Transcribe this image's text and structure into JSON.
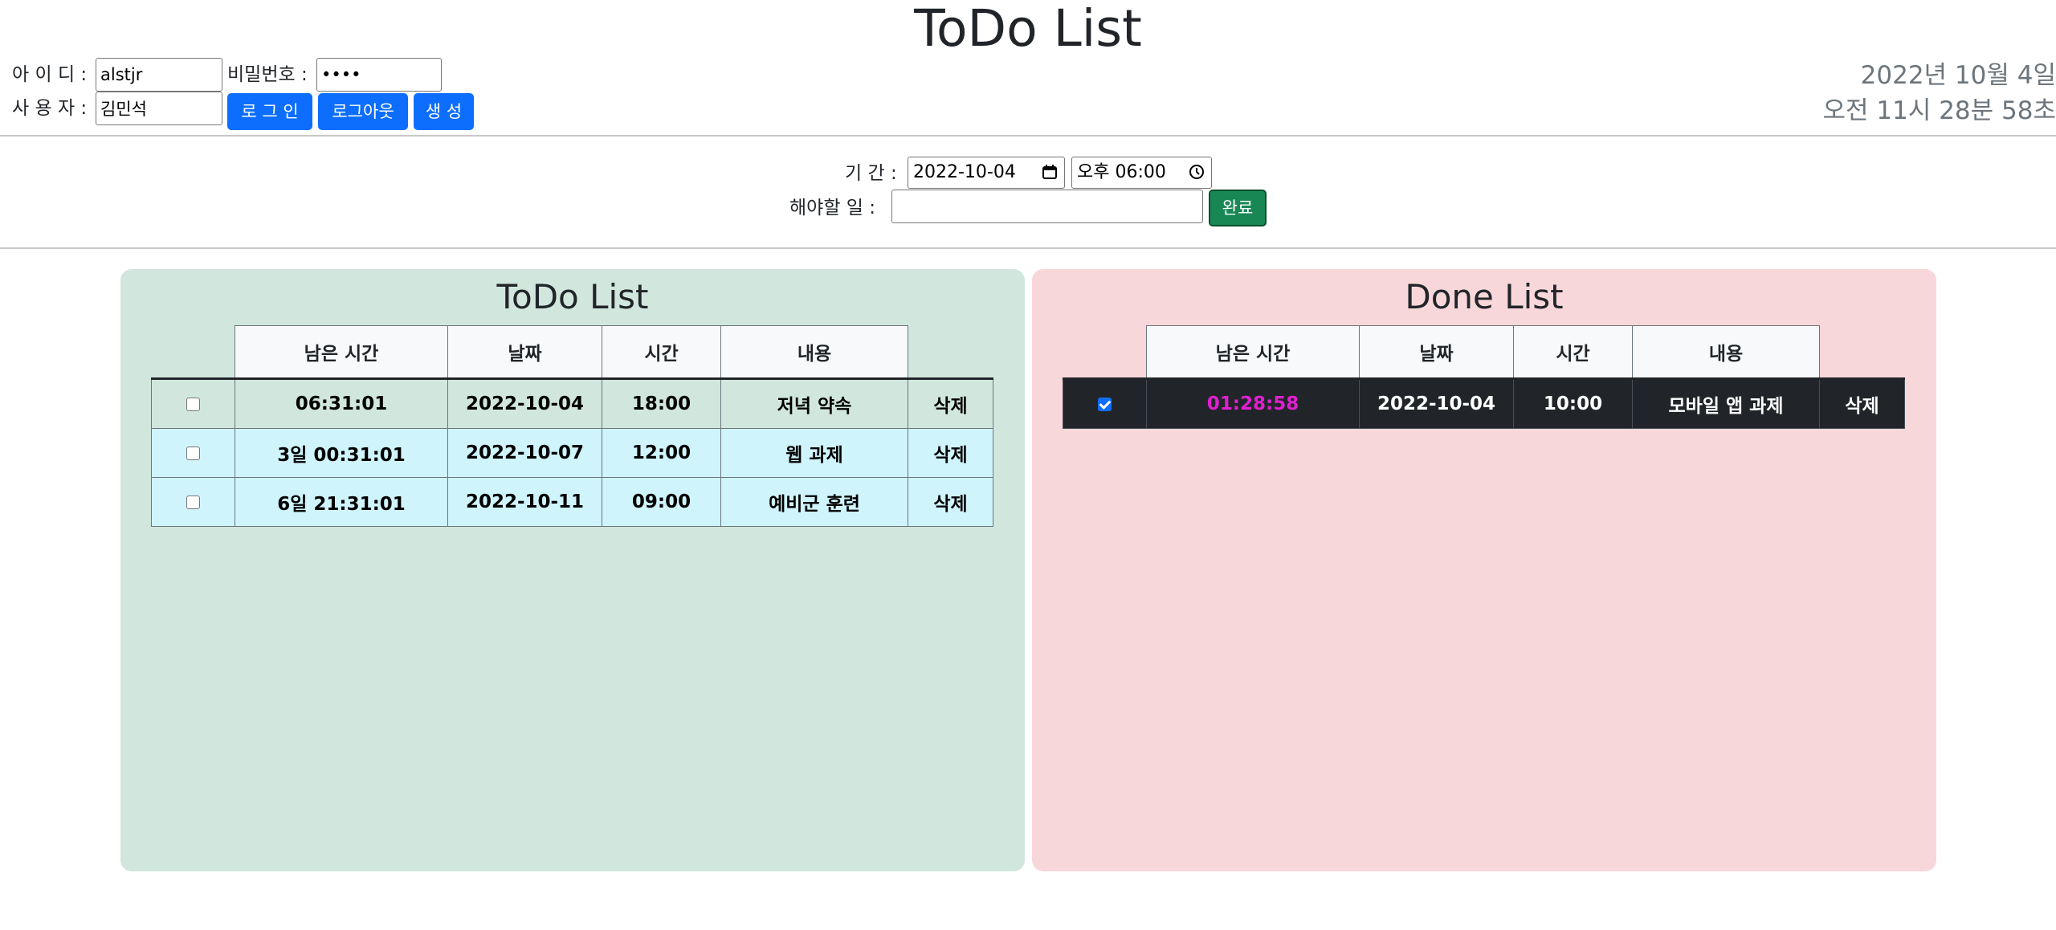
{
  "app_title": "ToDo List",
  "login": {
    "id_label": "아 이 디 :",
    "id_value": "alstjr",
    "password_label": "비밀번호 :",
    "password_value": "••••",
    "user_label": "사 용 자 :",
    "user_value": "김민석",
    "login_button": "로 그 인",
    "logout_button": "로그아웃",
    "create_button": "생 성"
  },
  "clock": {
    "date": "2022년 10월 4일",
    "time": "오전 11시 28분 58초"
  },
  "form": {
    "period_label": "기 간 :",
    "date_value": "2022-10-04",
    "time_value": "오후 06:00",
    "task_label": "해야할 일 :",
    "task_value": "",
    "submit_button": "완료"
  },
  "columns": [
    "남은 시간",
    "날짜",
    "시간",
    "내용"
  ],
  "todo": {
    "title": "ToDo List",
    "rows": [
      {
        "remaining": "06:31:01",
        "date": "2022-10-04",
        "time": "18:00",
        "content": "저녁 약속",
        "delete": "삭제",
        "checked": false
      },
      {
        "remaining": "3일 00:31:01",
        "date": "2022-10-07",
        "time": "12:00",
        "content": "웹 과제",
        "delete": "삭제",
        "checked": false
      },
      {
        "remaining": "6일 21:31:01",
        "date": "2022-10-11",
        "time": "09:00",
        "content": "예비군 훈련",
        "delete": "삭제",
        "checked": false
      }
    ]
  },
  "done": {
    "title": "Done List",
    "rows": [
      {
        "remaining": "01:28:58",
        "date": "2022-10-04",
        "time": "10:00",
        "content": "모바일 앱 과제",
        "delete": "삭제",
        "checked": true
      }
    ]
  },
  "colors": {
    "primary": "#0d6efd",
    "success": "#198754",
    "todo_panel": "#d1e7dd",
    "done_panel": "#f8d7da",
    "row_cyan": "#cff4fc",
    "row_dark": "#212529",
    "remaining_highlight": "#e020d0"
  }
}
